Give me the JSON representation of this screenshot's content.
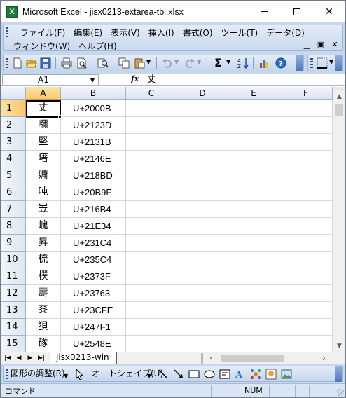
{
  "window": {
    "title": "Microsoft Excel - jisx0213-extarea-tbl.xlsx",
    "app_icon_letter": "X"
  },
  "menubar": {
    "items": [
      "ファイル(F)",
      "編集(E)",
      "表示(V)",
      "挿入(I)",
      "書式(O)",
      "ツール(T)",
      "データ(D)"
    ],
    "items_row2": [
      "ウィンドウ(W)",
      "ヘルプ(H)"
    ]
  },
  "toolbar": {
    "icons": [
      "new-icon",
      "open-icon",
      "save-icon",
      "print-icon",
      "print-preview-icon",
      "research-icon",
      "copy-icon",
      "paste-icon",
      "undo-icon",
      "redo-icon",
      "autosum-icon",
      "sort-ascending-icon",
      "chart-wizard-icon",
      "help-icon"
    ],
    "accent": "#c6d7ec"
  },
  "formula_bar": {
    "name_box": "A1",
    "fx_label": "fx",
    "value": "丈"
  },
  "grid": {
    "columns": [
      "A",
      "B",
      "C",
      "D",
      "E",
      "F"
    ],
    "active_column": "A",
    "active_row": "1",
    "rows": [
      {
        "num": "1",
        "a": "丈",
        "b": "U+2000B"
      },
      {
        "num": "2",
        "a": "𡄣",
        "b": "U+2123D"
      },
      {
        "num": "3",
        "a": "堅",
        "b": "U+2131B"
      },
      {
        "num": "4",
        "a": "墸",
        "b": "U+2146E"
      },
      {
        "num": "5",
        "a": "嫞",
        "b": "U+218BD"
      },
      {
        "num": "6",
        "a": "吨",
        "b": "U+20B9F"
      },
      {
        "num": "7",
        "a": "岦",
        "b": "U+216B4"
      },
      {
        "num": "8",
        "a": "㟴",
        "b": "U+21E34"
      },
      {
        "num": "9",
        "a": "昇",
        "b": "U+231C4"
      },
      {
        "num": "10",
        "a": "梳",
        "b": "U+235C4"
      },
      {
        "num": "11",
        "a": "樸",
        "b": "U+2373F"
      },
      {
        "num": "12",
        "a": "壽",
        "b": "U+23763"
      },
      {
        "num": "13",
        "a": "桼",
        "b": "U+23CFE"
      },
      {
        "num": "14",
        "a": "狽",
        "b": "U+247F1"
      },
      {
        "num": "15",
        "a": "䃍",
        "b": "U+2548E"
      }
    ]
  },
  "sheet_tabs": {
    "tabs": [
      "jisx0213-win"
    ]
  },
  "drawing_toolbar": {
    "draw_menu": "図形の調整(R)",
    "autoshape": "オートシェイプ(U)"
  },
  "status": {
    "mode": "コマンド",
    "num": "NUM"
  }
}
